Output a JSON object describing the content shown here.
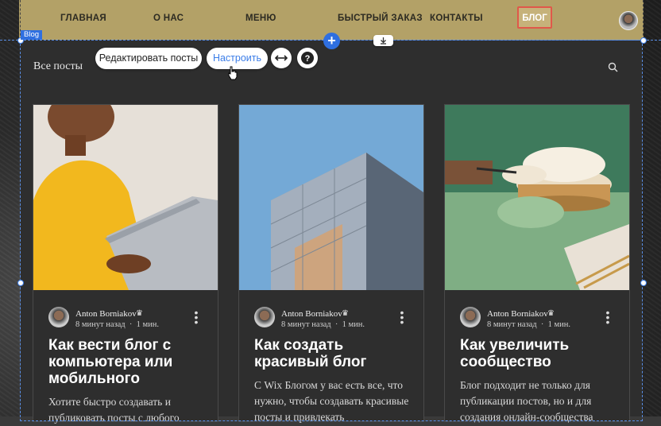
{
  "nav": {
    "items": [
      "ГЛАВНАЯ",
      "О НАС",
      "МЕНЮ",
      "БЫСТРЫЙ ЗАКАЗ",
      "КОНТАКТЫ"
    ],
    "active": "БЛОГ"
  },
  "editor": {
    "tag": "Blog",
    "edit_posts": "Редактировать посты",
    "settings": "Настроить"
  },
  "blog": {
    "all_posts": "Все посты",
    "posts": [
      {
        "author": "Anton Borniakov",
        "time": "8 минут назад",
        "read": "1 мин.",
        "title": "Как вести блог с компьютера или мобильного",
        "excerpt": "Хотите быстро создавать и публиковать посты с любого"
      },
      {
        "author": "Anton Borniakov",
        "time": "8 минут назад",
        "read": "1 мин.",
        "title": "Как создать красивый блог",
        "excerpt": "С Wix Блогом у вас есть все, что нужно, чтобы создавать красивые посты и привлекать"
      },
      {
        "author": "Anton Borniakov",
        "time": "8 минут назад",
        "read": "1 мин.",
        "title": "Как увеличить сообщество",
        "excerpt": "Блог подходит не только для публикации постов, но и для создания онлайн-сообщества"
      }
    ]
  },
  "colors": {
    "nav_bg": "#b3a167",
    "accent": "#2f6fe0",
    "highlight": "#e0584a"
  }
}
